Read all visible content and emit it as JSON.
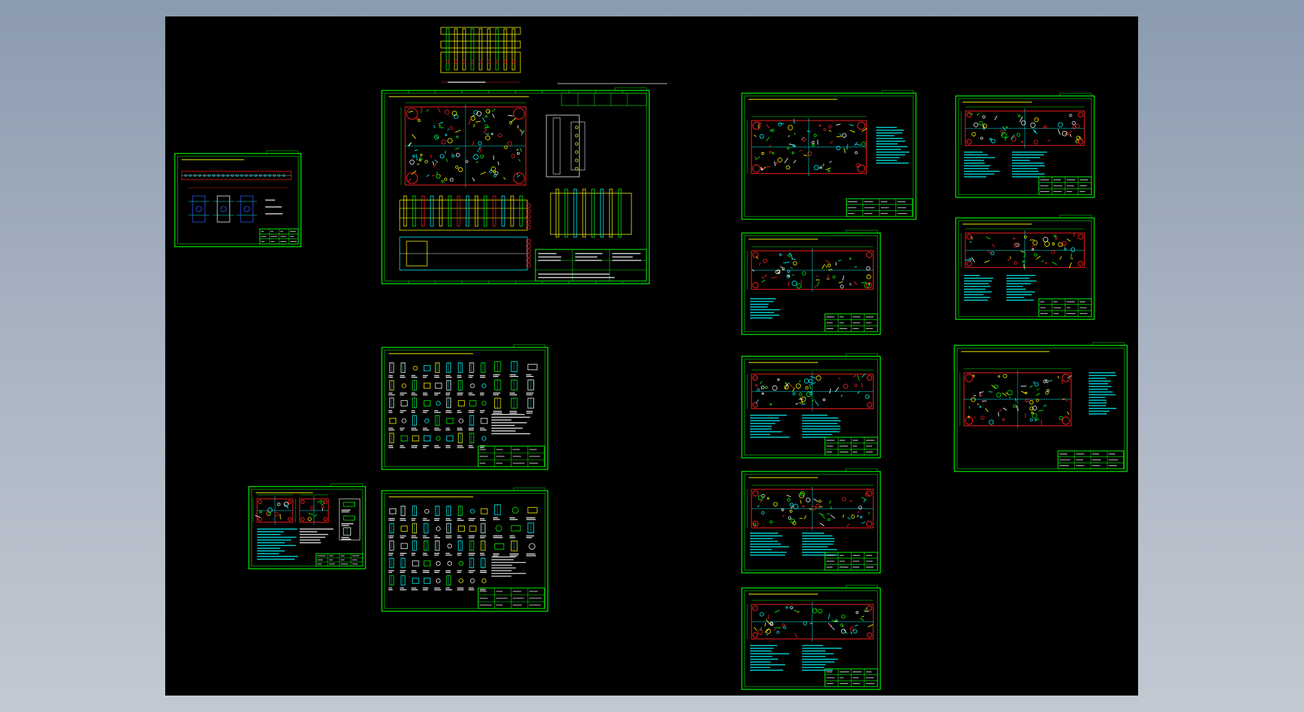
{
  "viewer": {
    "background_top": "#8b9bb0",
    "background_bottom": "#c3c9d3",
    "canvas_color": "#000000"
  },
  "colors": {
    "border": "#00ff00",
    "cyan": "#00ffff",
    "yellow": "#ffff00",
    "red": "#ff2020",
    "white": "#ffffff",
    "blue": "#3060ff"
  },
  "sheets": [
    {
      "id": "sheet-small-strip",
      "content": "strip-layout"
    },
    {
      "id": "sheet-main-assembly",
      "content": "assembly"
    },
    {
      "id": "sheet-parts-1",
      "content": "parts"
    },
    {
      "id": "sheet-parts-2",
      "content": "parts"
    },
    {
      "id": "sheet-small-parts",
      "content": "parts-small"
    },
    {
      "id": "sheet-plate-1",
      "content": "plate"
    },
    {
      "id": "sheet-plate-2",
      "content": "plate"
    },
    {
      "id": "sheet-plate-3",
      "content": "plate"
    },
    {
      "id": "sheet-plate-4",
      "content": "plate"
    },
    {
      "id": "sheet-plate-5",
      "content": "plate"
    },
    {
      "id": "sheet-plate-6",
      "content": "plate"
    },
    {
      "id": "sheet-plate-7",
      "content": "plate"
    },
    {
      "id": "sheet-plate-8",
      "content": "plate"
    },
    {
      "id": "sheet-top-detail",
      "content": "detail"
    }
  ]
}
